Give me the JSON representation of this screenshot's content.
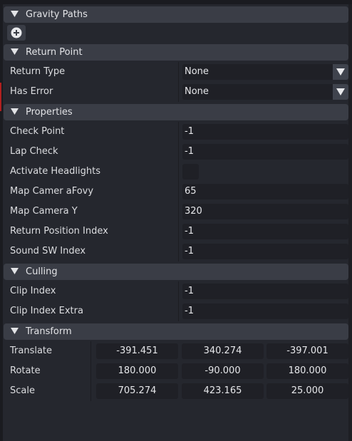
{
  "sections": {
    "gravity_paths": "Gravity Paths",
    "return_point": "Return Point",
    "properties": "Properties",
    "culling": "Culling",
    "transform": "Transform"
  },
  "return_point": {
    "return_type": {
      "label": "Return Type",
      "value": "None"
    },
    "has_error": {
      "label": "Has Error",
      "value": "None"
    }
  },
  "properties": {
    "check_point": {
      "label": "Check Point",
      "value": "-1"
    },
    "lap_check": {
      "label": "Lap Check",
      "value": "-1"
    },
    "activate_headlights": {
      "label": "Activate Headlights",
      "checked": false
    },
    "map_camera_fovy": {
      "label": "Map Camer aFovy",
      "value": "65"
    },
    "map_camera_y": {
      "label": "Map Camera Y",
      "value": "320"
    },
    "return_position_index": {
      "label": "Return Position Index",
      "value": "-1"
    },
    "sound_sw_index": {
      "label": "Sound SW Index",
      "value": "-1"
    }
  },
  "culling": {
    "clip_index": {
      "label": "Clip Index",
      "value": "-1"
    },
    "clip_index_extra": {
      "label": "Clip Index Extra",
      "value": "-1"
    }
  },
  "transform": {
    "translate": {
      "label": "Translate",
      "x": "-391.451",
      "y": "340.274",
      "z": "-397.001"
    },
    "rotate": {
      "label": "Rotate",
      "x": "180.000",
      "y": "-90.000",
      "z": "180.000"
    },
    "scale": {
      "label": "Scale",
      "x": "705.274",
      "y": "423.165",
      "z": "25.000"
    }
  },
  "icons": {
    "collapse": "triangle-down-icon",
    "add": "plus-circle-icon",
    "dropdown": "triangle-down-icon"
  },
  "colors": {
    "background": "#25272e",
    "section_header": "#3a3d46",
    "field": "#1f2026",
    "text": "#dcdde0"
  }
}
